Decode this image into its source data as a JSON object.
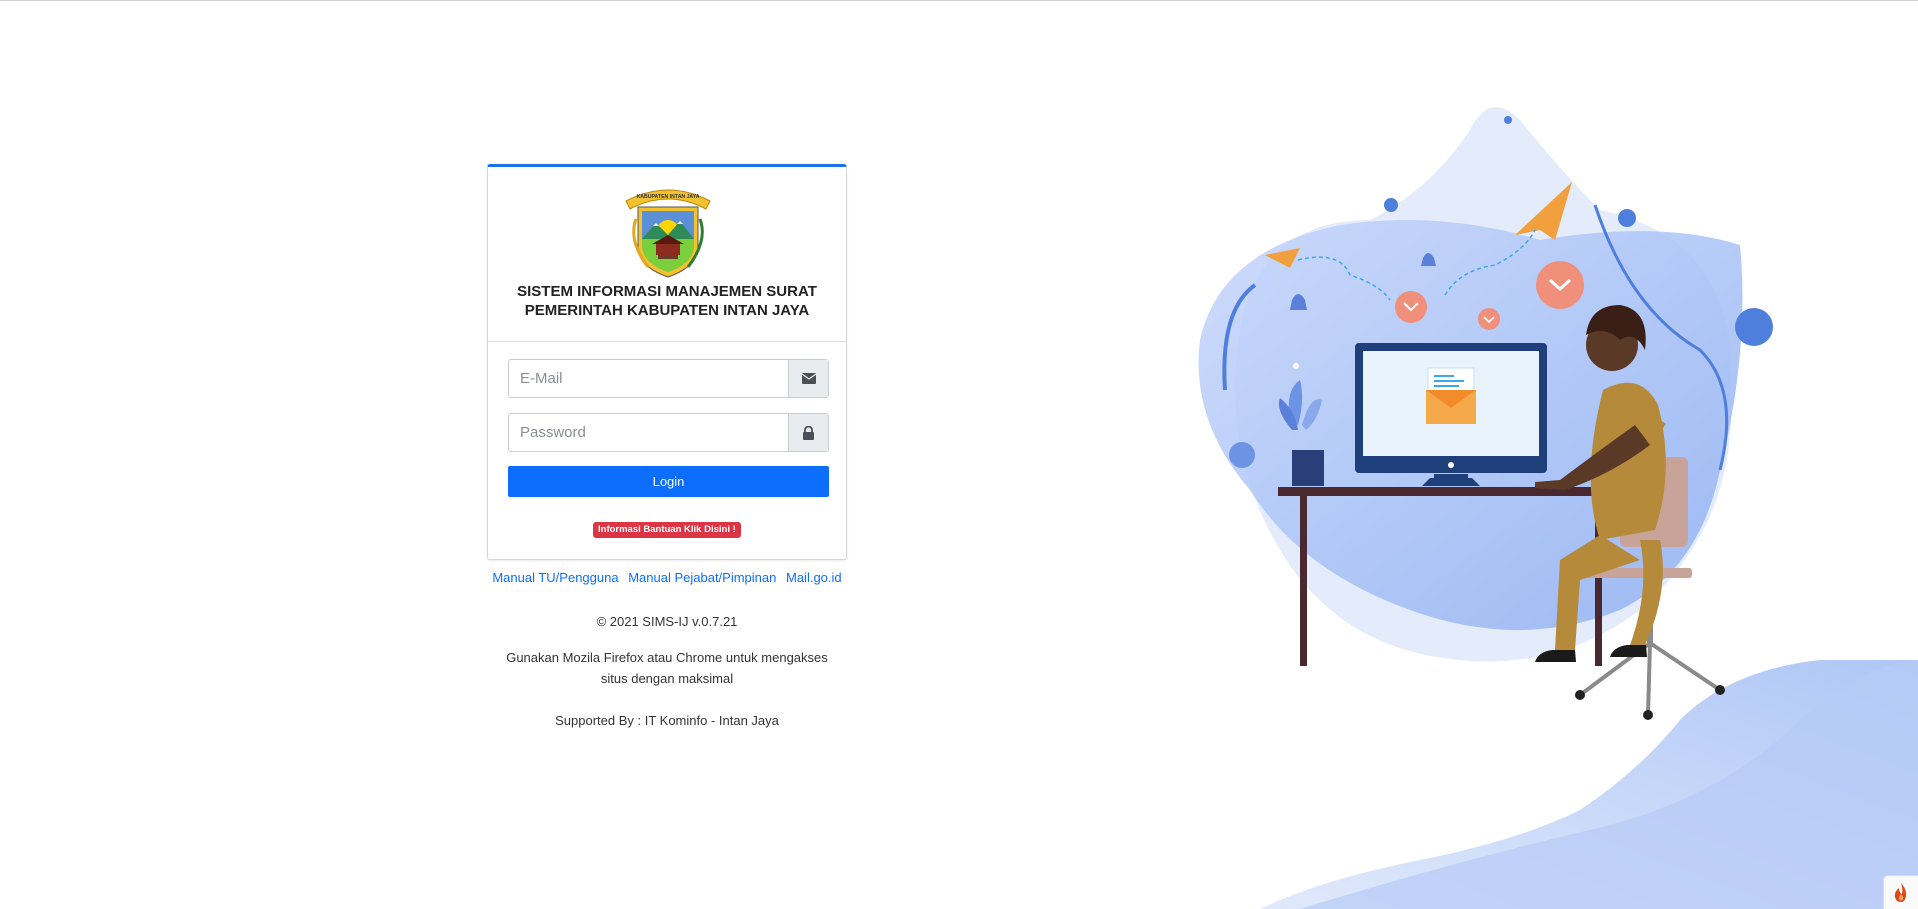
{
  "header": {
    "title_line1": "SISTEM INFORMASI MANAJEMEN SURAT",
    "title_line2": "PEMERINTAH KABUPATEN INTAN JAYA",
    "logo_ribbon_text": "KABUPATEN INTAN JAYA"
  },
  "form": {
    "email_placeholder": "E-Mail",
    "email_icon": "envelope-icon",
    "password_placeholder": "Password",
    "password_icon": "lock-icon",
    "login_label": "Login",
    "help_label": "Informasi Bantuan Klik Disini !"
  },
  "links": [
    {
      "label": "Manual TU/Pengguna"
    },
    {
      "label": "Manual Pejabat/Pimpinan"
    },
    {
      "label": "Mail.go.id"
    }
  ],
  "footer": {
    "copyright": "© 2021 SIMS-IJ v.0.7.21",
    "browser_note": "Gunakan Mozila Firefox atau Chrome untuk mengakses situs dengan maksimal",
    "supported_by": "Supported By : IT Kominfo - Intan Jaya"
  },
  "corner_icon": "flame-icon",
  "colors": {
    "primary": "#0d6efd",
    "danger": "#dc3545",
    "card_top_border": "#1a73e8",
    "illustration_blue": "#a9c1f7"
  }
}
